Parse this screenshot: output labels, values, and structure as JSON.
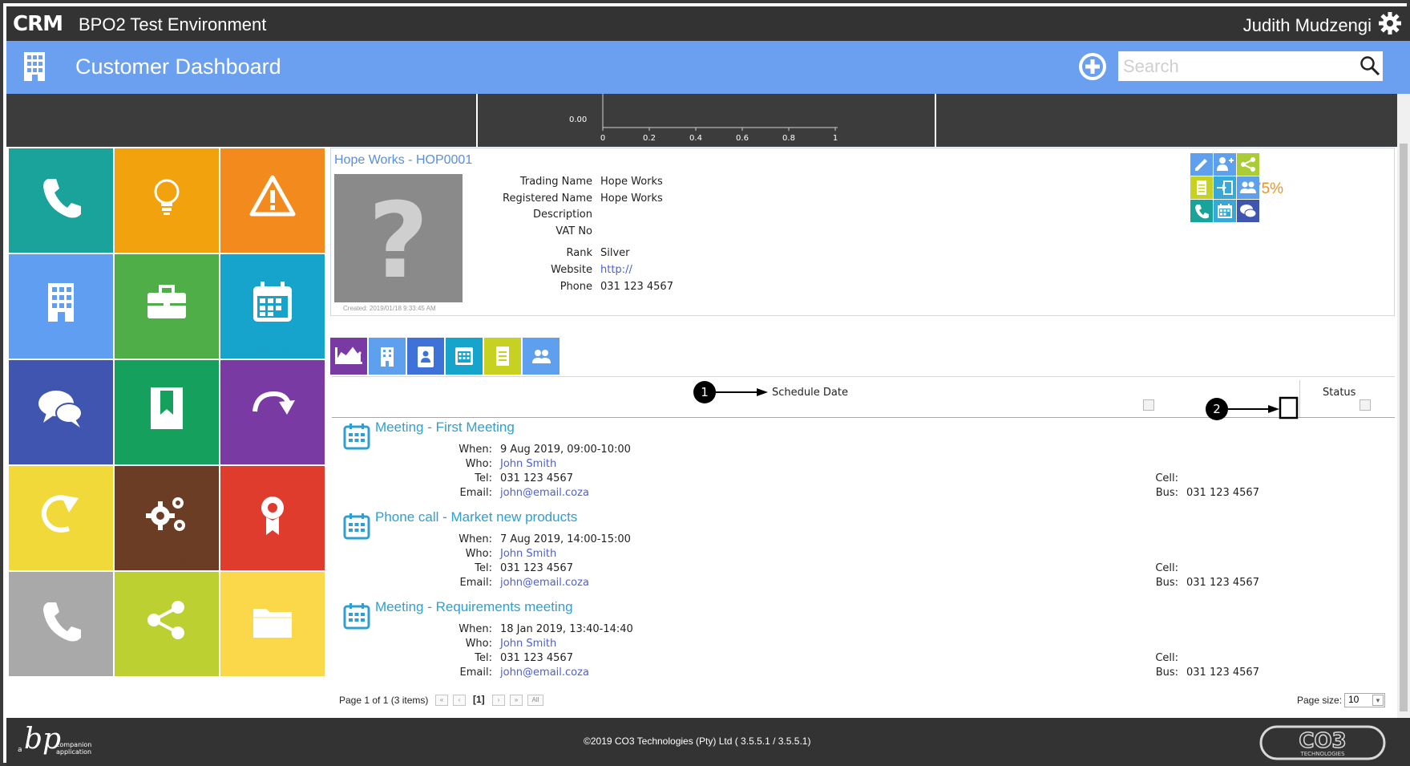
{
  "topbar": {
    "logo": "CRM",
    "env_title": "BPO2 Test Environment",
    "user": "Judith Mudzengi"
  },
  "header": {
    "title": "Customer Dashboard",
    "search_placeholder": "Search"
  },
  "chart": {
    "y_tick": "0.00",
    "x_ticks": [
      "0",
      "0.2",
      "0.4",
      "0.6",
      "0.8",
      "1"
    ]
  },
  "tiles": [
    {
      "label": "create cold call",
      "icon": "phone-icon",
      "color": "#1aa39a"
    },
    {
      "label": "recommendations",
      "icon": "lightbulb-icon",
      "color": "#f2a20d"
    },
    {
      "label": "warnings",
      "icon": "warning-icon",
      "color": "#f28a1e"
    },
    {
      "label": "customers",
      "icon": "building-icon",
      "color": "#5f9ef0"
    },
    {
      "label": "cases",
      "icon": "briefcase-icon",
      "color": "#4fae48"
    },
    {
      "label": "activities",
      "icon": "calendar-icon",
      "color": "#16a3cc"
    },
    {
      "label": "quotes",
      "icon": "chat-icon",
      "color": "#3f55b0"
    },
    {
      "label": "orders",
      "icon": "bookmark-icon",
      "color": "#16a05e"
    },
    {
      "label": "invoices",
      "icon": "redo-icon",
      "color": "#7a3aa3"
    },
    {
      "label": "credit notes",
      "icon": "undo-icon",
      "color": "#f2d93a"
    },
    {
      "label": "equipment",
      "icon": "gears-icon",
      "color": "#6b3d24"
    },
    {
      "label": "contracts",
      "icon": "award-icon",
      "color": "#e03c2e"
    },
    {
      "label": "service calls",
      "icon": "phone-icon",
      "color": "#a9a9a9"
    },
    {
      "label": "3rd party",
      "icon": "share-icon",
      "color": "#bcd032"
    },
    {
      "label": "files",
      "icon": "folder-icon",
      "color": "#fbd84a"
    }
  ],
  "customer": {
    "name": "Hope Works - HOP0001",
    "created": "Created: 2019/01/18 9:33:45 AM",
    "fields": [
      {
        "label": "Trading Name",
        "value": "Hope Works"
      },
      {
        "label": "Registered Name",
        "value": "Hope Works"
      },
      {
        "label": "Description",
        "value": ""
      },
      {
        "label": "VAT No",
        "value": ""
      },
      {
        "label": "Rank",
        "value": "Silver"
      },
      {
        "label": "Website",
        "value": "http://"
      },
      {
        "label": "Phone",
        "value": "031 123 4567"
      }
    ],
    "completion": "75%"
  },
  "grid": {
    "col_schedule": "Schedule Date",
    "col_status": "Status",
    "callout_1": "1",
    "callout_2": "2"
  },
  "activities": [
    {
      "title": "Meeting - First Meeting",
      "when": "9 Aug 2019, 09:00-10:00",
      "who": "John Smith",
      "tel": "031 123 4567",
      "email": "john@email.coza",
      "cell": "",
      "bus": "031 123 4567"
    },
    {
      "title": "Phone call - Market new products",
      "when": "7 Aug 2019, 14:00-15:00",
      "who": "John Smith",
      "tel": "031 123 4567",
      "email": "john@email.coza",
      "cell": "",
      "bus": "031 123 4567"
    },
    {
      "title": "Meeting - Requirements meeting",
      "when": "18 Jan 2019, 13:40-14:40",
      "who": "John Smith",
      "tel": "031 123 4567",
      "email": "john@email.coza",
      "cell": "",
      "bus": "031 123 4567"
    }
  ],
  "labels": {
    "when": "When:",
    "who": "Who:",
    "tel": "Tel:",
    "email": "Email:",
    "cell": "Cell:",
    "bus": "Bus:"
  },
  "pager": {
    "info": "Page 1 of 1 (3 items)",
    "current": "[1]",
    "all": "All",
    "page_size_label": "Page size:",
    "page_size": "10"
  },
  "footer": {
    "copyright": "©2019 CO3 Technologies (Pty) Ltd ( 3.5.5.1 / 3.5.5.1)",
    "bp_text_1": "companion",
    "bp_text_2": "application",
    "bp_prefix": "a",
    "co3_text": "TECHNOLOGIES"
  }
}
